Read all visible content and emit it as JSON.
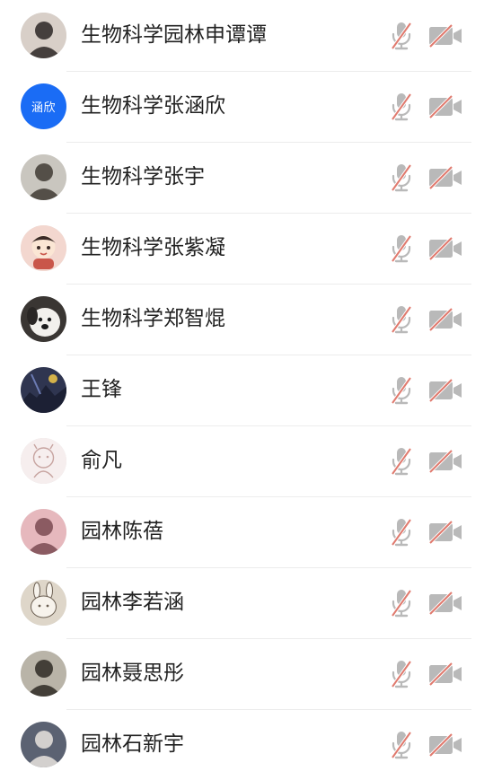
{
  "participants": [
    {
      "name": "生物科学园林申谭谭",
      "avatar": {
        "type": "image",
        "icon": "photo-avatar-icon",
        "bg": "#d8cfc8",
        "fg": "#2b2624"
      }
    },
    {
      "name": "生物科学张涵欣",
      "avatar": {
        "type": "text",
        "text": "涵欣",
        "bg": "#1a6cf5"
      }
    },
    {
      "name": "生物科学张宇",
      "avatar": {
        "type": "image",
        "icon": "photo-avatar-icon",
        "bg": "#c9c6bf",
        "fg": "#3f3a33"
      }
    },
    {
      "name": "生物科学张紫凝",
      "avatar": {
        "type": "image",
        "icon": "cartoon-avatar-icon",
        "bg": "#f3d7cf",
        "fg": "#c9564a"
      }
    },
    {
      "name": "生物科学郑智焜",
      "avatar": {
        "type": "image",
        "icon": "dog-avatar-icon",
        "bg": "#3a3633",
        "fg": "#f2f0ec"
      }
    },
    {
      "name": "王锋",
      "avatar": {
        "type": "image",
        "icon": "night-scene-avatar-icon",
        "bg": "#2f3550",
        "fg": "#d4b24a"
      }
    },
    {
      "name": "俞凡",
      "avatar": {
        "type": "image",
        "icon": "sketch-avatar-icon",
        "bg": "#f6eeee",
        "fg": "#c7a4a0"
      }
    },
    {
      "name": "园林陈蓓",
      "avatar": {
        "type": "image",
        "icon": "photo-avatar-icon",
        "bg": "#e6b8bd",
        "fg": "#7a4a52"
      }
    },
    {
      "name": "园林李若涵",
      "avatar": {
        "type": "image",
        "icon": "bunny-avatar-icon",
        "bg": "#ded6c9",
        "fg": "#6b5f52"
      }
    },
    {
      "name": "园林聂思彤",
      "avatar": {
        "type": "image",
        "icon": "photo-avatar-icon",
        "bg": "#b9b4a8",
        "fg": "#2e2a25"
      }
    },
    {
      "name": "园林石新宇",
      "avatar": {
        "type": "image",
        "icon": "photo-avatar-icon",
        "bg": "#5b6272",
        "fg": "#e9e4de"
      }
    }
  ],
  "icons": {
    "mic": "mic-muted-icon",
    "camera": "camera-off-icon"
  },
  "colors": {
    "icon_gray": "#b9b9b9",
    "slash_red": "#e07a6e",
    "divider": "#ececec",
    "text": "#222222"
  }
}
